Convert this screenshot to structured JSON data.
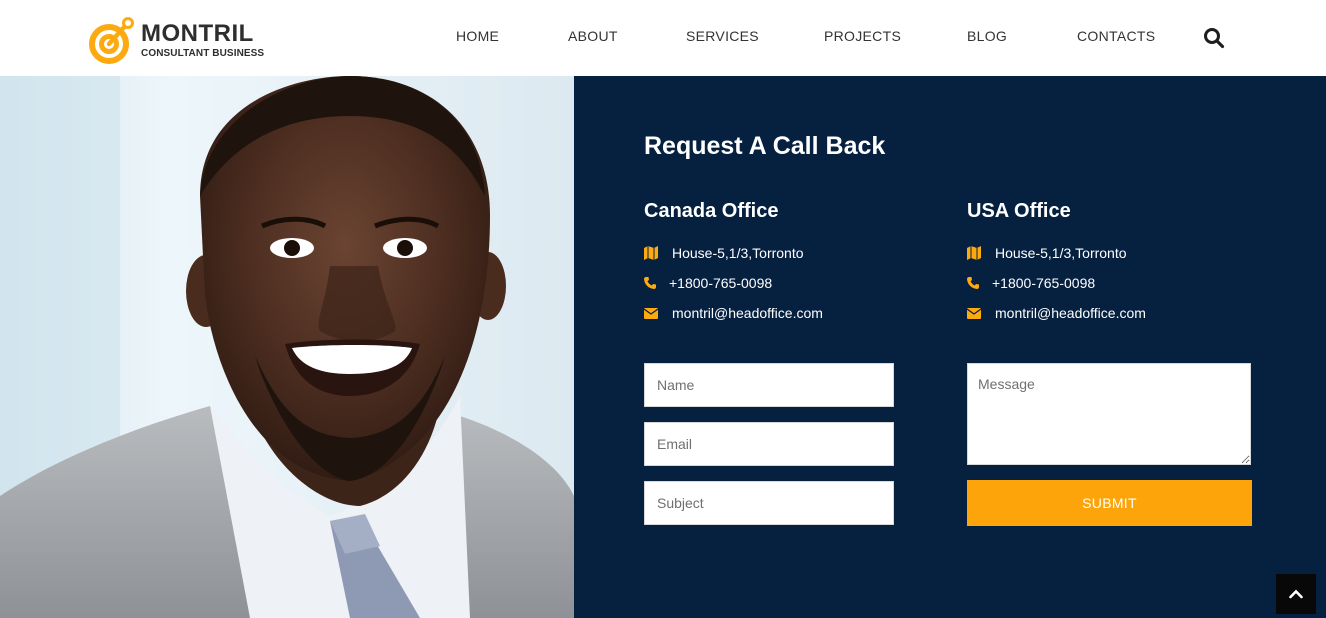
{
  "brand": {
    "name": "MONTRIL",
    "tagline": "CONSULTANT BUSINESS",
    "accent_color": "#fcaa0f",
    "logo_icon": "target-arrow-icon"
  },
  "nav": {
    "items": [
      {
        "label": "HOME"
      },
      {
        "label": "ABOUT"
      },
      {
        "label": "SERVICES"
      },
      {
        "label": "PROJECTS"
      },
      {
        "label": "BLOG"
      },
      {
        "label": "CONTACTS"
      }
    ],
    "search_icon": "search-icon"
  },
  "hero": {
    "image": "smiling-businessman-photo"
  },
  "contact": {
    "title": "Request A Call Back",
    "panel_color": "#062040",
    "offices": [
      {
        "name": "Canada Office",
        "address": "House-5,1/3,Torronto",
        "phone": "+1800-765-0098",
        "email": "montril@headoffice.com"
      },
      {
        "name": "USA Office",
        "address": "House-5,1/3,Torronto",
        "phone": "+1800-765-0098",
        "email": "montril@headoffice.com"
      }
    ],
    "icons": {
      "address": "map-icon",
      "phone": "phone-icon",
      "email": "envelope-icon"
    },
    "form": {
      "name_placeholder": "Name",
      "email_placeholder": "Email",
      "subject_placeholder": "Subject",
      "message_placeholder": "Message",
      "submit_label": "SUBMIT",
      "submit_color": "#fca40a"
    }
  },
  "back_to_top_icon": "chevron-up-icon"
}
